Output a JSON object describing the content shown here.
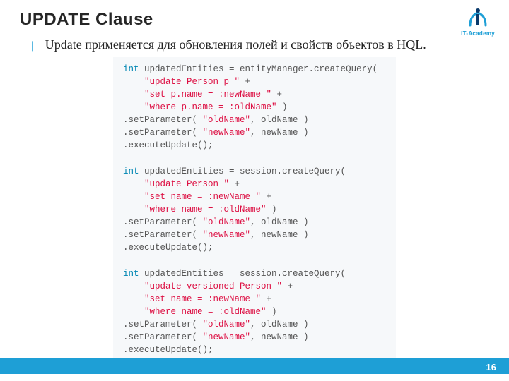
{
  "title": "UPDATE Clause",
  "bullet_glyph": "❘",
  "body": "Update применяется для обновления полей и свойств объектов в HQL.",
  "logo": {
    "text": "IT-Academy"
  },
  "page_number": "16",
  "colors": {
    "accent": "#1e9fd6"
  },
  "code_blocks": [
    {
      "tokens": [
        {
          "c": "kw",
          "t": "int"
        },
        {
          "c": "ident",
          "t": " updatedEntities = entityManager.createQuery("
        },
        {
          "c": "nl"
        },
        {
          "c": "ident",
          "t": "    "
        },
        {
          "c": "str",
          "t": "\"update Person p \""
        },
        {
          "c": "ident",
          "t": " +"
        },
        {
          "c": "nl"
        },
        {
          "c": "ident",
          "t": "    "
        },
        {
          "c": "str",
          "t": "\"set p.name = :newName \""
        },
        {
          "c": "ident",
          "t": " +"
        },
        {
          "c": "nl"
        },
        {
          "c": "ident",
          "t": "    "
        },
        {
          "c": "str",
          "t": "\"where p.name = :oldName\""
        },
        {
          "c": "ident",
          "t": " )"
        },
        {
          "c": "nl"
        },
        {
          "c": "ident",
          "t": ".setParameter( "
        },
        {
          "c": "str",
          "t": "\"oldName\""
        },
        {
          "c": "ident",
          "t": ", oldName )"
        },
        {
          "c": "nl"
        },
        {
          "c": "ident",
          "t": ".setParameter( "
        },
        {
          "c": "str",
          "t": "\"newName\""
        },
        {
          "c": "ident",
          "t": ", newName )"
        },
        {
          "c": "nl"
        },
        {
          "c": "ident",
          "t": ".executeUpdate();"
        },
        {
          "c": "nl"
        },
        {
          "c": "nl"
        },
        {
          "c": "kw",
          "t": "int"
        },
        {
          "c": "ident",
          "t": " updatedEntities = session.createQuery("
        },
        {
          "c": "nl"
        },
        {
          "c": "ident",
          "t": "    "
        },
        {
          "c": "str",
          "t": "\"update Person \""
        },
        {
          "c": "ident",
          "t": " +"
        },
        {
          "c": "nl"
        },
        {
          "c": "ident",
          "t": "    "
        },
        {
          "c": "str",
          "t": "\"set name = :newName \""
        },
        {
          "c": "ident",
          "t": " +"
        },
        {
          "c": "nl"
        },
        {
          "c": "ident",
          "t": "    "
        },
        {
          "c": "str",
          "t": "\"where name = :oldName\""
        },
        {
          "c": "ident",
          "t": " )"
        },
        {
          "c": "nl"
        },
        {
          "c": "ident",
          "t": ".setParameter( "
        },
        {
          "c": "str",
          "t": "\"oldName\""
        },
        {
          "c": "ident",
          "t": ", oldName )"
        },
        {
          "c": "nl"
        },
        {
          "c": "ident",
          "t": ".setParameter( "
        },
        {
          "c": "str",
          "t": "\"newName\""
        },
        {
          "c": "ident",
          "t": ", newName )"
        },
        {
          "c": "nl"
        },
        {
          "c": "ident",
          "t": ".executeUpdate();"
        },
        {
          "c": "nl"
        },
        {
          "c": "nl"
        },
        {
          "c": "kw",
          "t": "int"
        },
        {
          "c": "ident",
          "t": " updatedEntities = session.createQuery("
        },
        {
          "c": "nl"
        },
        {
          "c": "ident",
          "t": "    "
        },
        {
          "c": "str",
          "t": "\"update versioned Person \""
        },
        {
          "c": "ident",
          "t": " +"
        },
        {
          "c": "nl"
        },
        {
          "c": "ident",
          "t": "    "
        },
        {
          "c": "str",
          "t": "\"set name = :newName \""
        },
        {
          "c": "ident",
          "t": " +"
        },
        {
          "c": "nl"
        },
        {
          "c": "ident",
          "t": "    "
        },
        {
          "c": "str",
          "t": "\"where name = :oldName\""
        },
        {
          "c": "ident",
          "t": " )"
        },
        {
          "c": "nl"
        },
        {
          "c": "ident",
          "t": ".setParameter( "
        },
        {
          "c": "str",
          "t": "\"oldName\""
        },
        {
          "c": "ident",
          "t": ", oldName )"
        },
        {
          "c": "nl"
        },
        {
          "c": "ident",
          "t": ".setParameter( "
        },
        {
          "c": "str",
          "t": "\"newName\""
        },
        {
          "c": "ident",
          "t": ", newName )"
        },
        {
          "c": "nl"
        },
        {
          "c": "ident",
          "t": ".executeUpdate();"
        }
      ]
    }
  ]
}
